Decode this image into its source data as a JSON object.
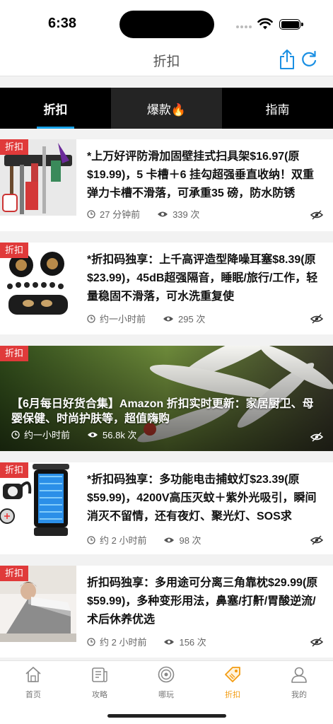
{
  "status": {
    "time": "6:38"
  },
  "nav": {
    "title": "折扣",
    "share_icon": "share-icon",
    "refresh_icon": "refresh-icon",
    "accent": "#1a8fe3"
  },
  "tabs": [
    {
      "label": "折扣",
      "active": true
    },
    {
      "label": "爆款🔥",
      "active": false
    },
    {
      "label": "指南",
      "active": false
    }
  ],
  "deals": [
    {
      "badge": "折扣",
      "title": "*上万好评防滑加固壁挂式扫具架$16.97(原$19.99)，5 卡槽＋6 挂勾超强垂直收纳！双重弹力卡槽不滑落，可承重35 磅，防水防锈",
      "time": "27 分钟前",
      "views": "339 次"
    },
    {
      "badge": "折扣",
      "title": "*折扣码独享：上千高评造型降噪耳塞$8.39(原$23.99)，45dB超强隔音，睡眠/旅行/工作，轻量稳固不滑落，可水洗重复使",
      "time": "约一小时前",
      "views": "295 次"
    },
    {
      "badge": "折扣",
      "title": "【6月每日好货合集】Amazon 折扣实时更新：家居厨卫、母婴保健、时尚护肤等，超值嗨购",
      "time": "约一小时前",
      "views": "56.8k 次"
    },
    {
      "badge": "折扣",
      "title": "*折扣码独享：多功能电击捕蚊灯$23.39(原$59.99)，4200V高压灭蚊＋紫外光吸引，瞬间消灭不留情，还有夜灯、聚光灯、SOS求",
      "time": "约 2 小时前",
      "views": "98 次"
    },
    {
      "badge": "折扣",
      "title": "折扣码独享：多用途可分离三角靠枕$29.99(原$59.99)，多种变形用法，鼻塞/打鼾/胃酸逆流/术后休养优选",
      "time": "约 2 小时前",
      "views": "156 次"
    }
  ],
  "bottom_tabs": [
    {
      "label": "首页",
      "icon": "home-icon",
      "active": false
    },
    {
      "label": "攻略",
      "icon": "guide-icon",
      "active": false
    },
    {
      "label": "哪玩",
      "icon": "target-icon",
      "active": false
    },
    {
      "label": "折扣",
      "icon": "tag-icon",
      "active": true
    },
    {
      "label": "我的",
      "icon": "profile-icon",
      "active": false
    }
  ],
  "colors": {
    "badge": "#e03a3a",
    "tab_active_underline": "#1aa3e8",
    "bottom_active": "#f39c12"
  }
}
